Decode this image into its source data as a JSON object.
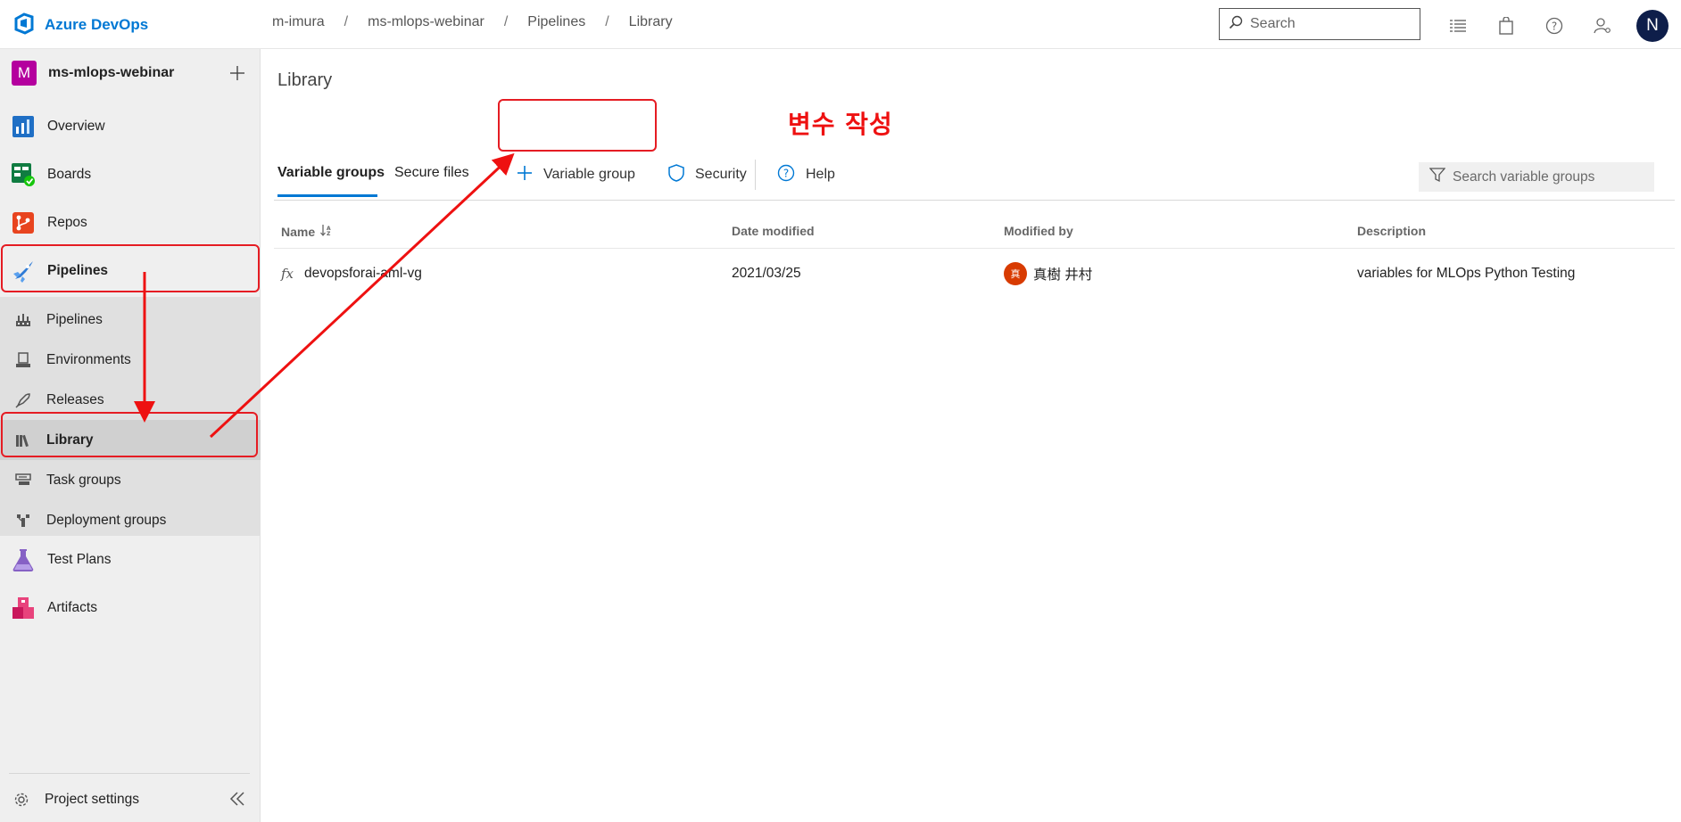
{
  "app": {
    "brand": "Azure DevOps"
  },
  "breadcrumbs": [
    "m-imura",
    "ms-mlops-webinar",
    "Pipelines",
    "Library"
  ],
  "header": {
    "search_placeholder": "Search",
    "avatar_initial": "N"
  },
  "colors": {
    "brand_blue": "#0078d4",
    "project_badge": "#b4009e",
    "annotation_red": "#e51c23",
    "avatar_dark": "#0e1e4a"
  },
  "sidebar": {
    "project_initial": "M",
    "project_name": "ms-mlops-webinar",
    "items": [
      {
        "label": "Overview",
        "icon": "overview-icon"
      },
      {
        "label": "Boards",
        "icon": "boards-icon"
      },
      {
        "label": "Repos",
        "icon": "repos-icon"
      },
      {
        "label": "Pipelines",
        "icon": "pipelines-icon"
      },
      {
        "label": "Test Plans",
        "icon": "test-plans-icon"
      },
      {
        "label": "Artifacts",
        "icon": "artifacts-icon"
      }
    ],
    "sub_items": [
      {
        "label": "Pipelines",
        "icon": "pipelines-sub-icon"
      },
      {
        "label": "Environments",
        "icon": "environments-icon"
      },
      {
        "label": "Releases",
        "icon": "releases-icon"
      },
      {
        "label": "Library",
        "icon": "library-icon"
      },
      {
        "label": "Task groups",
        "icon": "task-groups-icon"
      },
      {
        "label": "Deployment groups",
        "icon": "deployment-groups-icon"
      }
    ],
    "settings_label": "Project settings"
  },
  "main": {
    "title": "Library",
    "annotation": "변수 작성",
    "tabs": [
      "Variable groups",
      "Secure files"
    ],
    "commands": {
      "add_variable_group": "Variable group",
      "security": "Security",
      "help": "Help"
    },
    "filter_placeholder": "Search variable groups",
    "table": {
      "columns": [
        "Name",
        "Date modified",
        "Modified by",
        "Description"
      ],
      "rows": [
        {
          "name": "devopsforai-aml-vg",
          "date": "2021/03/25",
          "modified_by": "真樹 井村",
          "avatar_char": "真",
          "description": "variables for MLOps Python Testing"
        }
      ]
    }
  }
}
